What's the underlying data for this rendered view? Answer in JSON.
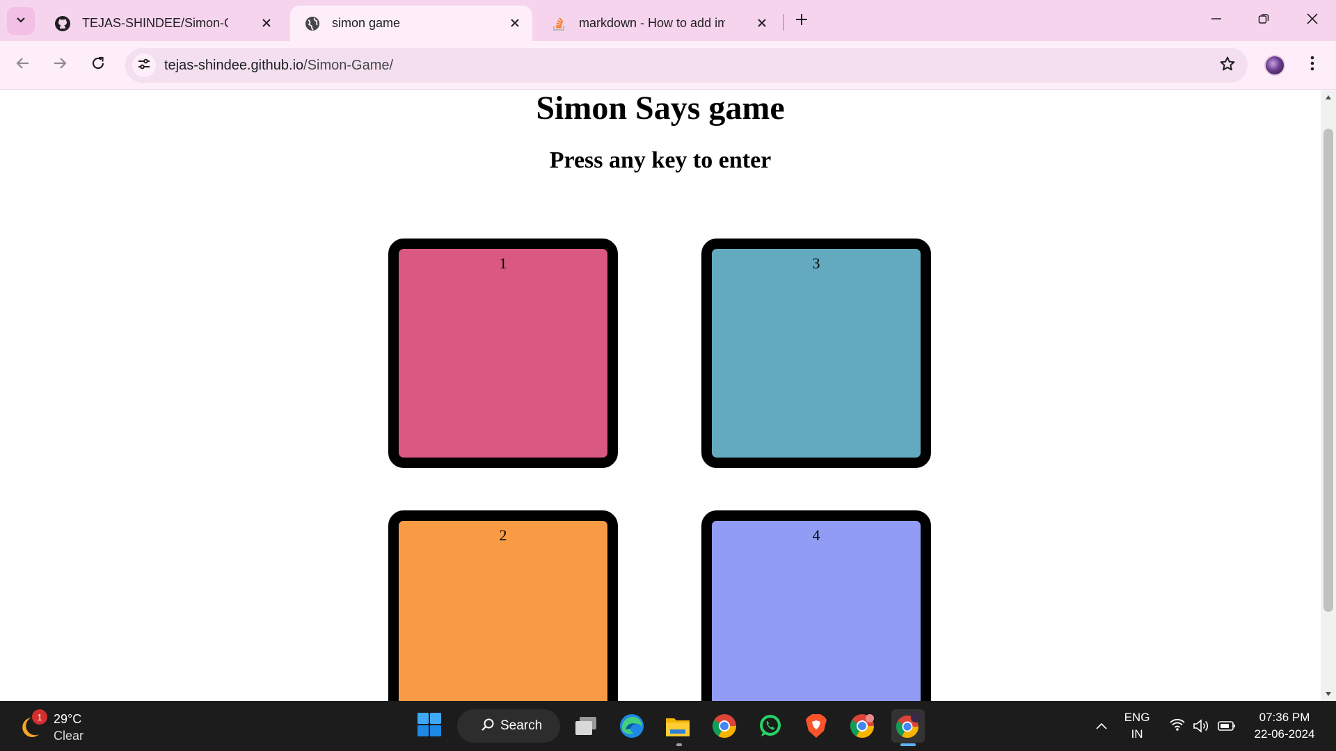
{
  "browser": {
    "tabs": [
      {
        "title": "TEJAS-SHINDEE/Simon-Game: …",
        "icon": "github-icon",
        "active": false
      },
      {
        "title": "simon game",
        "icon": "globe-icon",
        "active": true
      },
      {
        "title": "markdown - How to add image…",
        "icon": "stackoverflow-icon",
        "active": false
      }
    ],
    "url_host": "tejas-shindee.github.io",
    "url_path": "/Simon-Game/"
  },
  "page": {
    "title": "Simon Says game",
    "subtitle": "Press any key to enter",
    "buttons": [
      {
        "label": "1",
        "color": "#d95980"
      },
      {
        "label": "3",
        "color": "#63aac0"
      },
      {
        "label": "2",
        "color": "#f99b45"
      },
      {
        "label": "4",
        "color": "#919df5"
      }
    ]
  },
  "taskbar": {
    "weather": {
      "badge": "1",
      "temp": "29°C",
      "condition": "Clear"
    },
    "search_label": "Search",
    "language": {
      "line1": "ENG",
      "line2": "IN"
    },
    "clock": {
      "time": "07:36 PM",
      "date": "22-06-2024"
    }
  }
}
